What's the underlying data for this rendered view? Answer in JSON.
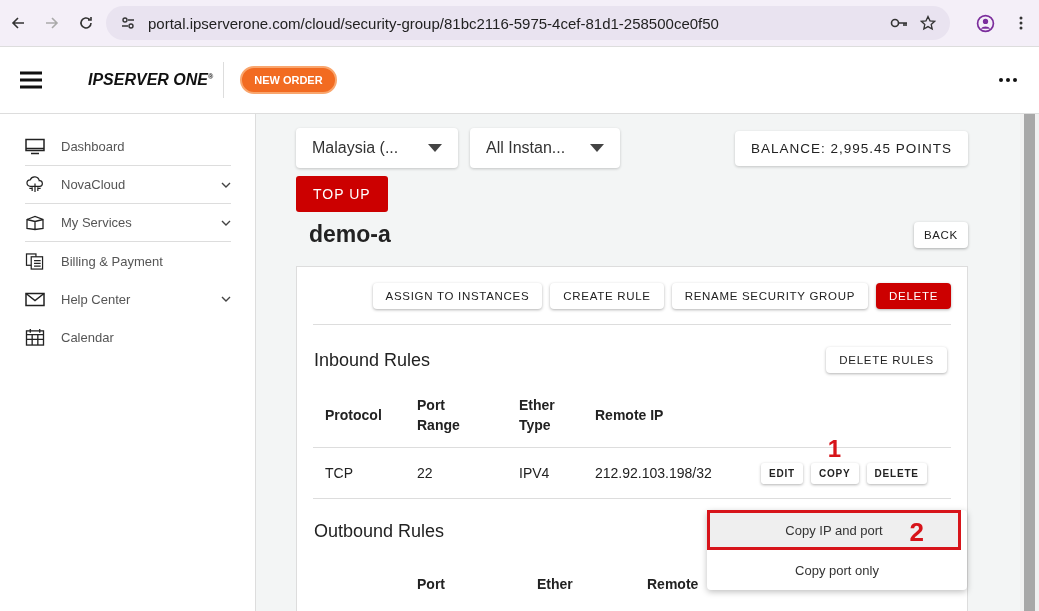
{
  "browser": {
    "url": "portal.ipserverone.com/cloud/security-group/81bc2116-5975-4cef-81d1-258500ce0f50"
  },
  "header": {
    "logo": "IPSERVER ONE",
    "logo_mark": "®",
    "new_order": "NEW ORDER"
  },
  "sidebar": {
    "items": [
      {
        "label": "Dashboard",
        "kind": "link"
      },
      {
        "label": "NovaCloud",
        "kind": "group"
      },
      {
        "label": "My Services",
        "kind": "group"
      },
      {
        "label": "Billing & Payment",
        "kind": "link"
      },
      {
        "label": "Help Center",
        "kind": "group"
      },
      {
        "label": "Calendar",
        "kind": "link"
      }
    ]
  },
  "filters": [
    {
      "value": "Malaysia (..."
    },
    {
      "value": "All Instan..."
    }
  ],
  "balance": "BALANCE: 2,995.45 POINTS",
  "top_up": "TOP UP",
  "title": "demo-a",
  "back": "BACK",
  "actions": [
    {
      "label": "ASSIGN TO INSTANCES",
      "kind": "plain"
    },
    {
      "label": "CREATE RULE",
      "kind": "plain"
    },
    {
      "label": "RENAME SECURITY GROUP",
      "kind": "plain"
    },
    {
      "label": "DELETE",
      "kind": "danger"
    }
  ],
  "inbound": {
    "title": "Inbound Rules",
    "delete_rules": "DELETE RULES",
    "columns": [
      "Protocol",
      "Port Range",
      "Ether Type",
      "Remote IP"
    ],
    "rows": [
      {
        "cells": [
          "TCP",
          "22",
          "IPV4",
          "212.92.103.198/32"
        ],
        "buttons": [
          "EDIT",
          "COPY",
          "DELETE"
        ]
      }
    ]
  },
  "outbound": {
    "title": "Outbound Rules",
    "columns": [
      "Port",
      "Ether",
      "Remote"
    ]
  },
  "copy_menu": {
    "items": [
      {
        "label": "Copy IP and port",
        "selected": true
      },
      {
        "label": "Copy port only",
        "selected": false
      }
    ]
  },
  "annotations": [
    {
      "label": "1"
    },
    {
      "label": "2"
    }
  ]
}
